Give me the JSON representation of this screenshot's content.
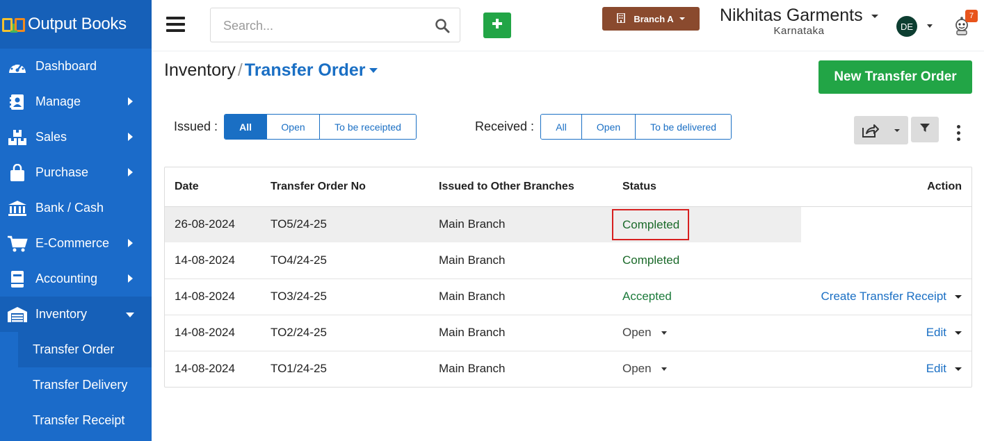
{
  "app": {
    "title": "Output Books"
  },
  "sidebar": {
    "items": [
      {
        "label": "Dashboard",
        "icon": "dashboard-gauge-icon",
        "has_children": false
      },
      {
        "label": "Manage",
        "icon": "address-book-icon",
        "has_children": true
      },
      {
        "label": "Sales",
        "icon": "boxes-icon",
        "has_children": true
      },
      {
        "label": "Purchase",
        "icon": "shopping-bag-icon",
        "has_children": true
      },
      {
        "label": "Bank / Cash",
        "icon": "bank-icon",
        "has_children": false
      },
      {
        "label": "E-Commerce",
        "icon": "shopping-cart-icon",
        "has_children": true
      },
      {
        "label": "Accounting",
        "icon": "ledger-book-icon",
        "has_children": true
      },
      {
        "label": "Inventory",
        "icon": "warehouse-icon",
        "has_children": true,
        "expanded": true
      }
    ],
    "sub_items": [
      {
        "label": "Transfer Order",
        "selected": true
      },
      {
        "label": "Transfer Delivery",
        "selected": false
      },
      {
        "label": "Transfer Receipt",
        "selected": false
      }
    ]
  },
  "topbar": {
    "search_placeholder": "Search...",
    "branch_label": "Branch A",
    "company_name": "Nikhitas Garments",
    "company_state": "Karnataka",
    "avatar_initials": "DE",
    "notification_count": "7"
  },
  "page": {
    "breadcrumb_root": "Inventory",
    "breadcrumb_sep": "/",
    "breadcrumb_current": "Transfer Order",
    "new_button": "New Transfer Order"
  },
  "filters": {
    "issued": {
      "label": "Issued :",
      "options": [
        "All",
        "Open",
        "To be receipted"
      ],
      "selected": "All"
    },
    "received": {
      "label": "Received :",
      "options": [
        "All",
        "Open",
        "To be delivered"
      ],
      "selected": ""
    }
  },
  "table": {
    "headers": [
      "Date",
      "Transfer Order No",
      "Issued to Other Branches",
      "Status",
      "Action"
    ],
    "rows": [
      {
        "date": "26-08-2024",
        "no": "TO5/24-25",
        "branch": "Main Branch",
        "status": "Completed",
        "action": ""
      },
      {
        "date": "14-08-2024",
        "no": "TO4/24-25",
        "branch": "Main Branch",
        "status": "Completed",
        "action": ""
      },
      {
        "date": "14-08-2024",
        "no": "TO3/24-25",
        "branch": "Main Branch",
        "status": "Accepted",
        "action": "Create Transfer Receipt"
      },
      {
        "date": "14-08-2024",
        "no": "TO2/24-25",
        "branch": "Main Branch",
        "status": "Open",
        "action": "Edit"
      },
      {
        "date": "14-08-2024",
        "no": "TO1/24-25",
        "branch": "Main Branch",
        "status": "Open",
        "action": "Edit"
      }
    ]
  },
  "colors": {
    "sidebar_bg": "#1b6bc9",
    "primary": "#1a6fc4",
    "success_button": "#22a546",
    "branch_button": "#8a4a2e",
    "status_green": "#1b6a2a",
    "highlight_border": "#d71f1f"
  }
}
